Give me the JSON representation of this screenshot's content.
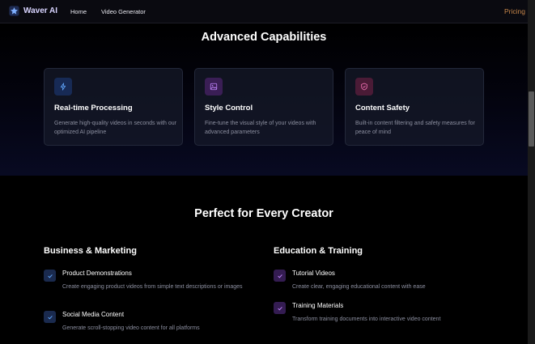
{
  "nav": {
    "logo_icon": "waver-logo-icon",
    "brand": "Waver AI",
    "links": [
      "Home",
      "Video Generator"
    ],
    "pricing": "Pricing"
  },
  "capabilities": {
    "title": "Advanced Capabilities",
    "cards": [
      {
        "icon": "lightning-icon",
        "title": "Real-time Processing",
        "desc": "Generate high-quality videos in seconds with our optimized AI pipeline"
      },
      {
        "icon": "image-icon",
        "title": "Style Control",
        "desc": "Fine-tune the visual style of your videos with advanced parameters"
      },
      {
        "icon": "shield-check-icon",
        "title": "Content Safety",
        "desc": "Built-in content filtering and safety measures for peace of mind"
      }
    ]
  },
  "creator": {
    "title": "Perfect for Every Creator",
    "columns": [
      {
        "heading": "Business & Marketing",
        "items": [
          {
            "title": "Product Demonstrations",
            "desc": "Create engaging product videos from simple text descriptions or images"
          },
          {
            "title": "Social Media Content",
            "desc": "Generate scroll-stopping video content for all platforms"
          }
        ]
      },
      {
        "heading": "Education & Training",
        "items": [
          {
            "title": "Tutorial Videos",
            "desc": "Create clear, engaging educational content with ease"
          },
          {
            "title": "Training Materials",
            "desc": "Transform training documents into interactive video content"
          }
        ]
      }
    ]
  },
  "colors": {
    "accent_blue": "#3b82f6",
    "accent_purple": "#a855f7",
    "accent_pink": "#ec4899",
    "pricing": "#c8874a"
  }
}
